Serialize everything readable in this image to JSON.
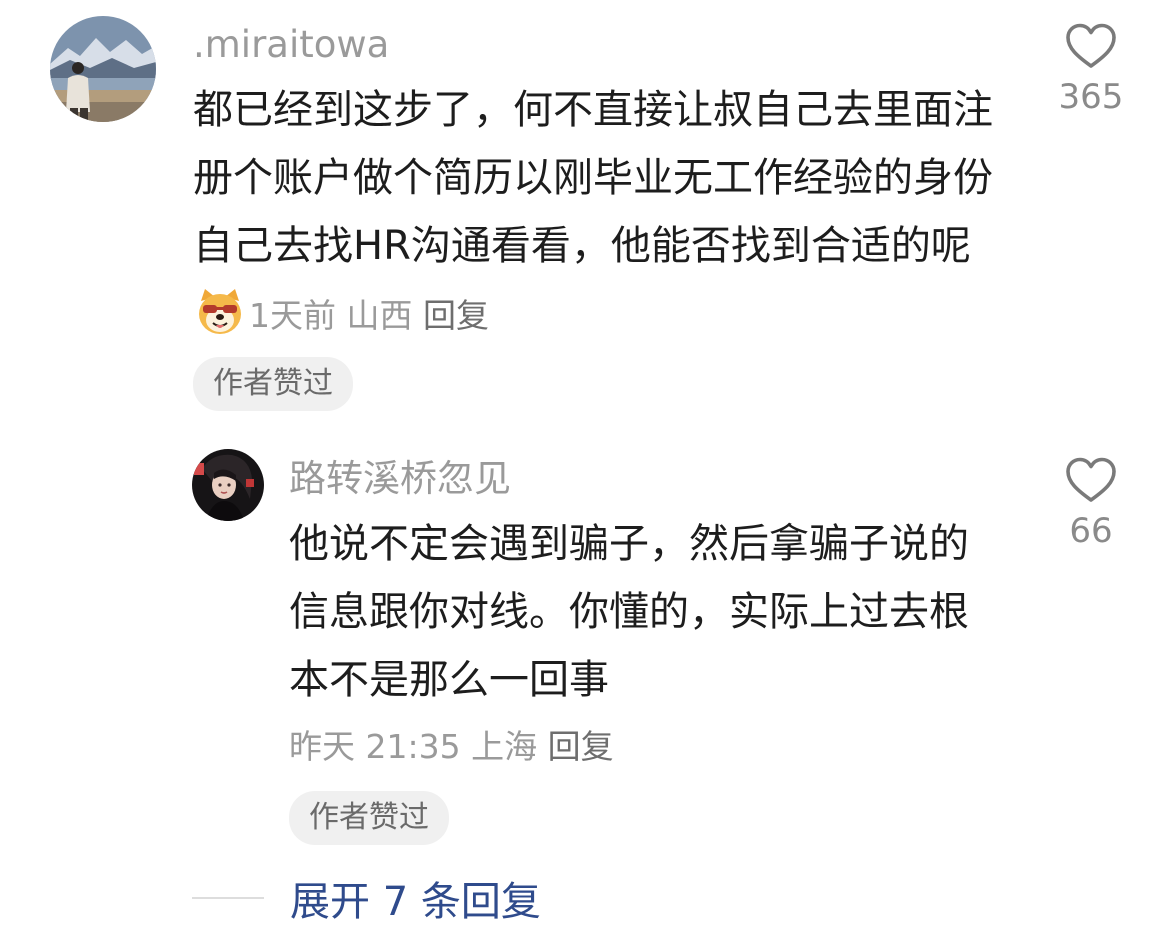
{
  "comments": [
    {
      "username": ".miraitowa",
      "text": "都已经到这步了，何不直接让叔自己去里面注册个账户做个简历以刚毕业无工作经验的身份自己去找HR沟通看看，他能否找到合适的呢",
      "time": "1天前",
      "location": "山西",
      "reply_label": "回复",
      "liked_badge": "作者赞过",
      "like_count": "365",
      "emoji": "dog-face-sunglasses"
    },
    {
      "username": "路转溪桥忽见",
      "text": "他说不定会遇到骗子，然后拿骗子说的信息跟你对线。你懂的，实际上过去根本不是那么一回事",
      "time": "昨天 21:35",
      "location": "上海",
      "reply_label": "回复",
      "liked_badge": "作者赞过",
      "like_count": "66"
    }
  ],
  "expand_replies": {
    "label": "展开 7 条回复"
  },
  "colors": {
    "username": "#9a9a9a",
    "link": "#2f4b8c",
    "badge_bg": "#f0f0f0"
  }
}
